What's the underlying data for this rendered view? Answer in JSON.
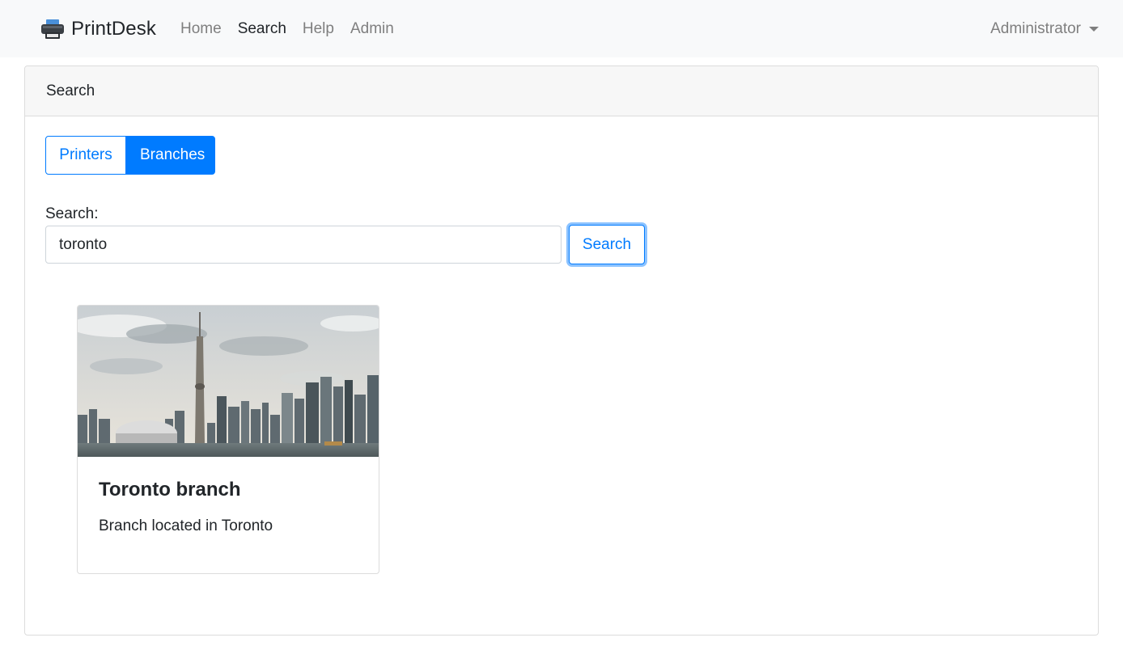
{
  "navbar": {
    "brand": "PrintDesk",
    "brand_icon": "printer-icon",
    "links": [
      "Home",
      "Search",
      "Help",
      "Admin"
    ],
    "active_link": "Search",
    "user": "Administrator"
  },
  "search_panel": {
    "header": "Search",
    "toggle": {
      "options": [
        "Printers",
        "Branches"
      ],
      "selected": "Branches"
    },
    "search_label": "Search:",
    "search_value": "toronto",
    "search_button": "Search"
  },
  "results": [
    {
      "title": "Toronto branch",
      "description": "Branch located in Toronto",
      "image": "toronto-skyline-image"
    }
  ],
  "colors": {
    "primary": "#007bff",
    "navbar_bg": "#f8f9fa",
    "card_header_bg": "#f7f7f7",
    "muted_text": "#7f7f7f"
  }
}
